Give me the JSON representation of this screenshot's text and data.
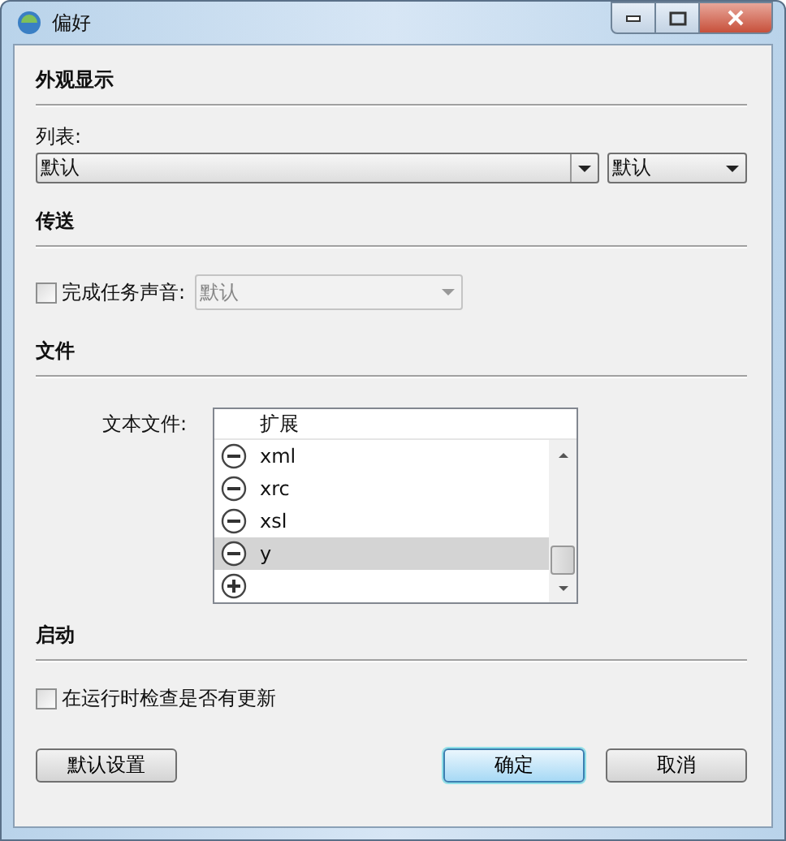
{
  "window": {
    "title": "偏好"
  },
  "appearance": {
    "heading": "外观显示",
    "list_label": "列表:",
    "list_combo": {
      "value": "默认"
    },
    "second_combo": {
      "value": "默认"
    }
  },
  "transfer": {
    "heading": "传送",
    "sound": {
      "label": "完成任务声音:",
      "checked": false
    },
    "sound_combo": {
      "value": "默认",
      "disabled": true
    }
  },
  "files": {
    "heading": "文件",
    "label": "文本文件:",
    "table": {
      "columns": [
        "扩展"
      ],
      "rows": [
        {
          "kind": "entry",
          "value": "xml",
          "selected": false
        },
        {
          "kind": "entry",
          "value": "xrc",
          "selected": false
        },
        {
          "kind": "entry",
          "value": "xsl",
          "selected": false
        },
        {
          "kind": "entry",
          "value": "y",
          "selected": true
        },
        {
          "kind": "add",
          "selected": false
        }
      ]
    }
  },
  "startup": {
    "heading": "启动",
    "check_updates": {
      "label": "在运行时检查是否有更新",
      "checked": false
    }
  },
  "buttons": [
    {
      "label": "默认设置",
      "default": false
    },
    {
      "label": "确定",
      "default": true
    },
    {
      "label": "取消",
      "default": false
    }
  ]
}
